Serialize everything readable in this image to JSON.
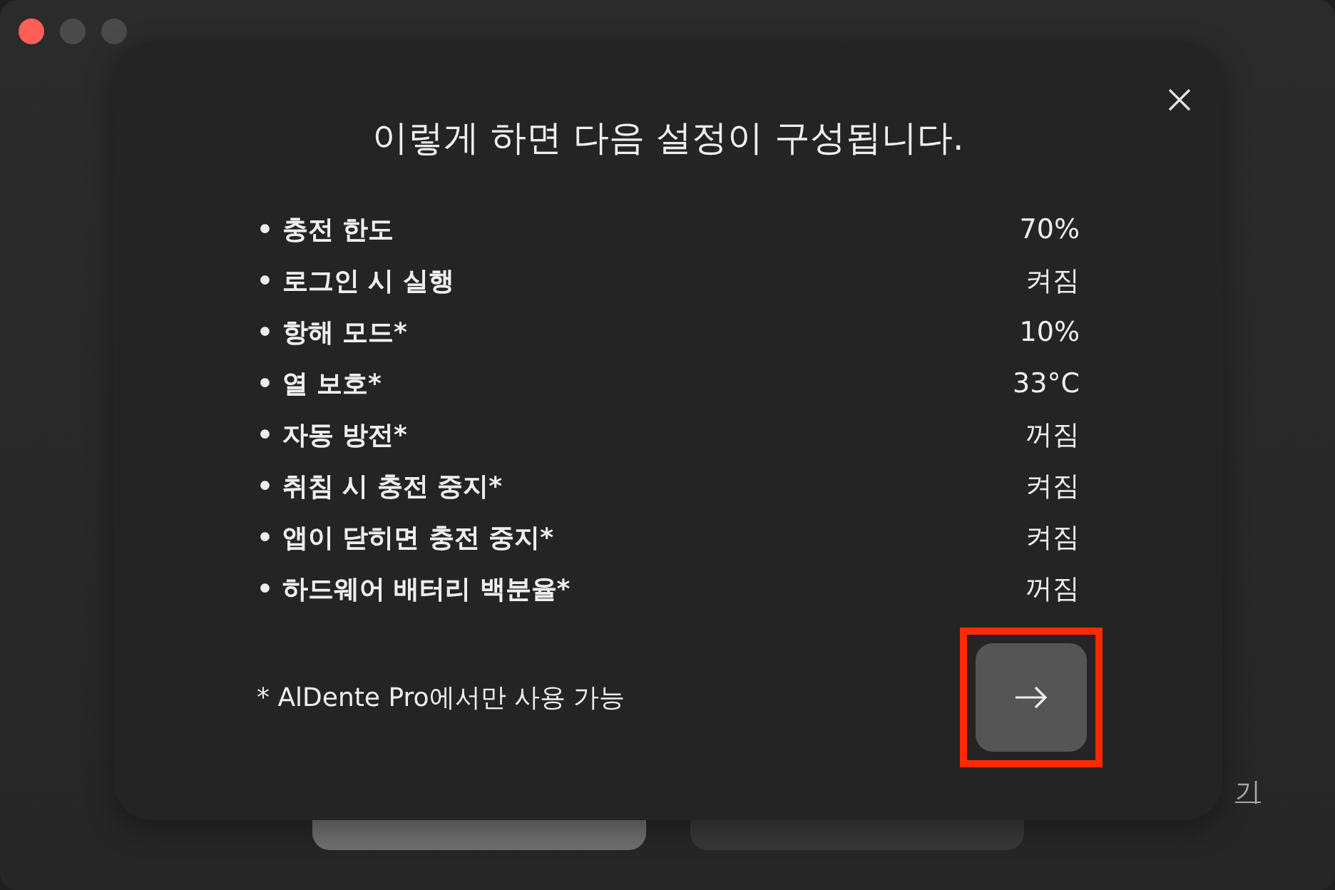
{
  "background": {
    "buttons": [
      {
        "kind": "primary"
      },
      {
        "kind": "secondary"
      }
    ],
    "link": "기"
  },
  "dialog": {
    "title": "이렇게 하면 다음 설정이 구성됩니다.",
    "settings": [
      {
        "label": "• 충전 한도",
        "value": "70%"
      },
      {
        "label": "• 로그인 시 실행",
        "value": "켜짐"
      },
      {
        "label": "• 항해 모드*",
        "value": "10%"
      },
      {
        "label": "• 열 보호*",
        "value": "33°C"
      },
      {
        "label": "• 자동 방전*",
        "value": "꺼짐"
      },
      {
        "label": "• 취침 시 충전 중지*",
        "value": "켜짐"
      },
      {
        "label": "• 앱이 닫히면 충전 중지*",
        "value": "켜짐"
      },
      {
        "label": "• 하드웨어 배터리 백분율*",
        "value": "꺼짐"
      }
    ],
    "footnote": "* AlDente Pro에서만 사용 가능",
    "next_button": {
      "highlighted": true
    }
  }
}
